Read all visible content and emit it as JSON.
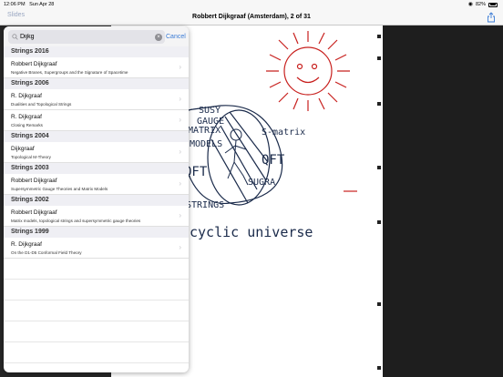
{
  "status_bar": {
    "time": "12:06 PM",
    "date": "Sun Apr 28",
    "battery": "82%"
  },
  "nav": {
    "back_label": "Slides",
    "title": "Robbert Dijkgraaf (Amsterdam), 2 of 31"
  },
  "search": {
    "query": "Dijkg",
    "placeholder": "Search",
    "cancel_label": "Cancel"
  },
  "sections": [
    {
      "header": "Strings 2016",
      "items": [
        {
          "author": "Robbert Dijkgraaf",
          "talk": "Negative Branes, Supergroups and the Signature of Spacetime"
        }
      ]
    },
    {
      "header": "Strings 2006",
      "items": [
        {
          "author": "R. Dijkgraaf",
          "talk": "Dualities and Topological Strings"
        },
        {
          "author": "R. Dijkgraaf",
          "talk": "Closing Remarks"
        }
      ]
    },
    {
      "header": "Strings 2004",
      "items": [
        {
          "author": "Dijkgraaf",
          "talk": "Topological M-Theory"
        }
      ]
    },
    {
      "header": "Strings 2003",
      "items": [
        {
          "author": "Robbert Dijkgraaf",
          "talk": "Supersymmetric Gauge Theories and Matrix Models"
        }
      ]
    },
    {
      "header": "Strings 2002",
      "items": [
        {
          "author": "Robbert Dijkgraaf",
          "talk": "Matrix models, topological strings and supersymmetric gauge theories"
        }
      ]
    },
    {
      "header": "Strings 1999",
      "items": [
        {
          "author": "R. Dijkgraaf",
          "talk": "On the D1-D5 Conformal Field Theory"
        }
      ]
    }
  ],
  "slide": {
    "wheel_labels": [
      "SUSY GAUGE",
      "MATRIX MODELS",
      "QFT",
      "STRINGS",
      "S-matrix",
      "QFT",
      "SUGRA"
    ],
    "caption": "cyclic universe"
  },
  "colors": {
    "accent": "#3a7bd5",
    "sun": "#c8201e",
    "ink": "#1a2a4a"
  }
}
